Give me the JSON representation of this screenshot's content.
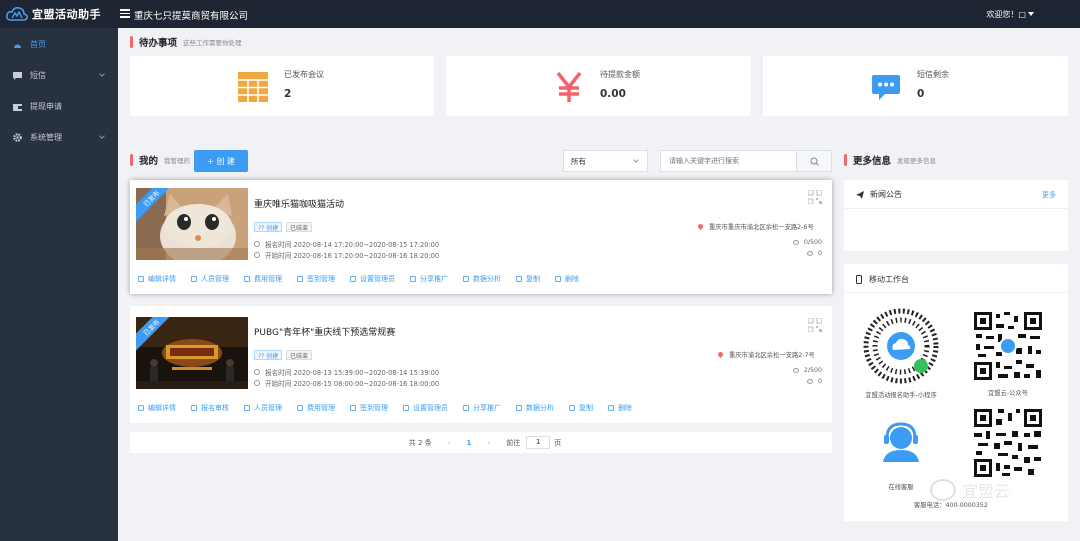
{
  "app": {
    "logo_text": "宜盟活动助手",
    "company": "重庆七只提莫商贸有限公司",
    "welcome": "欢迎您！□"
  },
  "sidebar": {
    "items": [
      {
        "label": "首页",
        "icon": "dashboard-icon",
        "active": true
      },
      {
        "label": "短信",
        "icon": "message-icon",
        "has_arrow": true
      },
      {
        "label": "提现申请",
        "icon": "wallet-icon"
      },
      {
        "label": "系统管理",
        "icon": "gear-icon",
        "has_arrow": true
      }
    ]
  },
  "todo": {
    "title": "待办事项",
    "subtitle": "这些工作需要你处理",
    "cards": [
      {
        "label": "已发布会议",
        "value": "2",
        "icon": "grid-icon",
        "color": "#f0a940"
      },
      {
        "label": "待提款金额",
        "value": "0.00",
        "icon": "yen-icon",
        "color": "#f3636c"
      },
      {
        "label": "短信剩余",
        "value": "0",
        "icon": "chat-icon",
        "color": "#3c9cf4"
      }
    ]
  },
  "mine": {
    "title": "我的",
    "subtitle": "我管理的",
    "create_label": "+ 创 建",
    "filter_value": "所有",
    "search_placeholder": "请输入关键字进行搜索"
  },
  "events": [
    {
      "ribbon": "已发布",
      "title": "重庆唯乐猫咖吸猫活动",
      "tags": [
        "?? 创建",
        "已结束"
      ],
      "signup_time": "报名时间 2020-08-14 17:20:00~2020-08-15 17:20:00",
      "start_time": "开始时间 2020-08-16 17:20:00~2020-08-16 18:20:00",
      "location": "重庆市重庆市渝北区余松一支路2-6号",
      "people": "0/500",
      "views": "0",
      "actions": [
        "编辑详情",
        "人员管理",
        "费用管理",
        "签到管理",
        "设置管理员",
        "分享推广",
        "数据分析",
        "复制",
        "删除"
      ]
    },
    {
      "ribbon": "已发布",
      "title": "PUBG\"青年杯\"重庆线下预选常规赛",
      "tags": [
        "?? 创建",
        "已结束"
      ],
      "signup_time": "报名时间 2020-08-13 15:39:00~2020-08-14 15:39:00",
      "start_time": "开始时间 2020-08-15 08:00:00~2020-08-16 18:00:00",
      "location": "重庆市渝北区余松一支路2-7号",
      "people": "2/500",
      "views": "0",
      "actions": [
        "编辑详情",
        "报名审核",
        "人员管理",
        "费用管理",
        "签到管理",
        "设置管理员",
        "分享推广",
        "数据分析",
        "复制",
        "删除"
      ]
    }
  ],
  "pager": {
    "total": "共 2 条",
    "current": "1",
    "goto_label": "前往",
    "goto_value": "1",
    "page_suffix": "页"
  },
  "more": {
    "title": "更多信息",
    "subtitle": "发现更多信息",
    "news_title": "新闻公告",
    "news_more": "更多",
    "mobile_title": "移动工作台",
    "qr_items": [
      {
        "caption": "宜盟活动报名助手-小程序",
        "kind": "mini-program"
      },
      {
        "caption": "宜盟云-公众号",
        "kind": "qr"
      },
      {
        "caption": "在线客服",
        "kind": "support"
      },
      {
        "caption": "",
        "kind": "qr"
      }
    ],
    "phone_text": "客服电话：400-0000352"
  },
  "watermark": "宜盟云"
}
